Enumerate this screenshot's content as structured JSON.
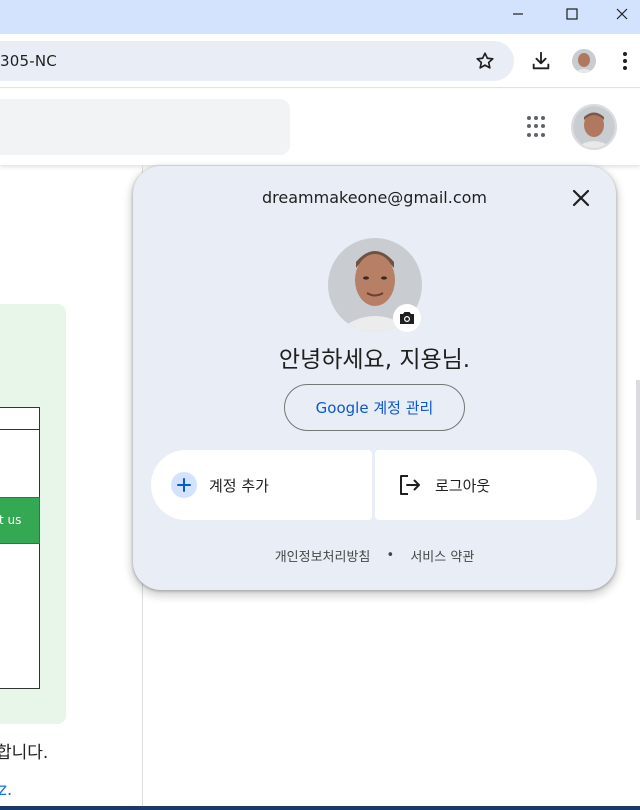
{
  "browser": {
    "omnibox_text": "305-NC"
  },
  "account": {
    "email": "dreammakeone@gmail.com",
    "greeting": "안녕하세요, 지용님.",
    "manage_label": "Google 계정 관리",
    "add_account_label": "계정 추가",
    "logout_label": "로그아웃",
    "privacy_label": "개인정보처리방침",
    "separator": "•",
    "terms_label": "서비스 약관"
  },
  "page": {
    "green_button_label": "t us",
    "fragment_text": "합니다.",
    "fragment_link": "z."
  },
  "colors": {
    "titlebar": "#d3e3fd",
    "popup_bg": "#e9eef6",
    "accent_blue": "#0b57d0",
    "green": "#34a853"
  }
}
